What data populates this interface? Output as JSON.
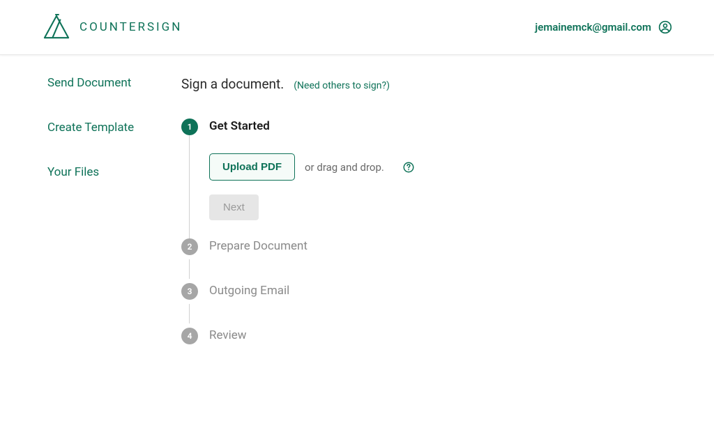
{
  "brand": {
    "name": "COUNTERSIGN"
  },
  "user": {
    "email": "jemainemck@gmail.com"
  },
  "sidebar": {
    "items": [
      {
        "label": "Send Document"
      },
      {
        "label": "Create Template"
      },
      {
        "label": "Your Files"
      }
    ]
  },
  "main": {
    "title": "Sign a document.",
    "sublink": "(Need others to sign?)",
    "steps": [
      {
        "num": "1",
        "label": "Get Started",
        "active": true
      },
      {
        "num": "2",
        "label": "Prepare Document",
        "active": false
      },
      {
        "num": "3",
        "label": "Outgoing Email",
        "active": false
      },
      {
        "num": "4",
        "label": "Review",
        "active": false
      }
    ],
    "upload": {
      "button": "Upload PDF",
      "dragText": "or drag and drop.",
      "next": "Next"
    }
  },
  "colors": {
    "primary": "#0e7258",
    "muted": "#a6a6a6"
  }
}
